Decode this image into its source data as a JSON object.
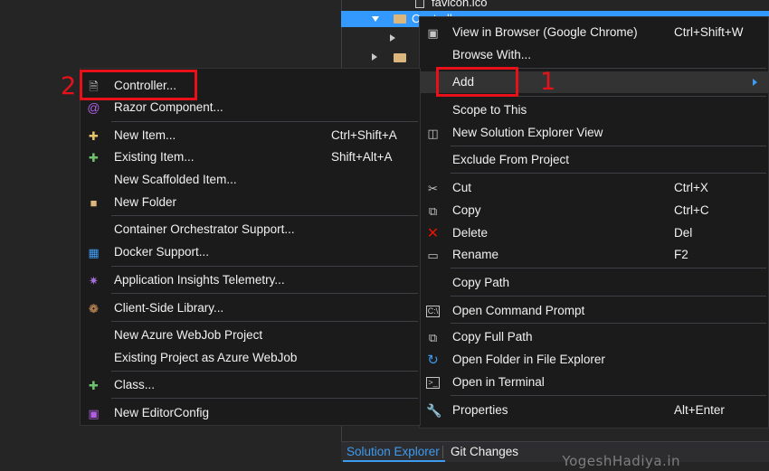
{
  "solution_explorer": {
    "tree": [
      {
        "label": "favicon.ico"
      },
      {
        "label": "Controllers"
      },
      {
        "label": ""
      },
      {
        "label": ""
      }
    ],
    "tabs": [
      {
        "label": "Solution Explorer"
      },
      {
        "label": "Git Changes"
      }
    ]
  },
  "main_menu": {
    "items": [
      {
        "label": "View in Browser (Google Chrome)",
        "shortcut": "Ctrl+Shift+W",
        "icon": "browser-icon"
      },
      {
        "label": "Browse With...",
        "shortcut": "",
        "icon": ""
      },
      {
        "label": "Add",
        "shortcut": "",
        "icon": "",
        "submenu": true
      },
      {
        "label": "Scope to This",
        "shortcut": "",
        "icon": ""
      },
      {
        "label": "New Solution Explorer View",
        "shortcut": "",
        "icon": "new-view-icon"
      },
      {
        "label": "Exclude From Project",
        "shortcut": "",
        "icon": ""
      },
      {
        "label": "Cut",
        "shortcut": "Ctrl+X",
        "icon": "scissors-icon"
      },
      {
        "label": "Copy",
        "shortcut": "Ctrl+C",
        "icon": "copy-icon"
      },
      {
        "label": "Delete",
        "shortcut": "Del",
        "icon": "delete-icon"
      },
      {
        "label": "Rename",
        "shortcut": "F2",
        "icon": "rename-icon"
      },
      {
        "label": "Copy Path",
        "shortcut": "",
        "icon": ""
      },
      {
        "label": "Open Command Prompt",
        "shortcut": "",
        "icon": "command-prompt-icon"
      },
      {
        "label": "Copy Full Path",
        "shortcut": "",
        "icon": "copy-full-path-icon"
      },
      {
        "label": "Open Folder in File Explorer",
        "shortcut": "",
        "icon": "refresh-arrow-icon"
      },
      {
        "label": "Open in Terminal",
        "shortcut": "",
        "icon": "terminal-icon"
      },
      {
        "label": "Properties",
        "shortcut": "Alt+Enter",
        "icon": "wrench-icon"
      }
    ]
  },
  "sub_menu": {
    "items": [
      {
        "label": "Controller...",
        "shortcut": "",
        "icon": "controller-file-icon"
      },
      {
        "label": "Razor Component...",
        "shortcut": "",
        "icon": "razor-icon"
      },
      {
        "label": "New Item...",
        "shortcut": "Ctrl+Shift+A",
        "icon": "new-item-icon"
      },
      {
        "label": "Existing Item...",
        "shortcut": "Shift+Alt+A",
        "icon": "existing-item-icon"
      },
      {
        "label": "New Scaffolded Item...",
        "shortcut": "",
        "icon": ""
      },
      {
        "label": "New Folder",
        "shortcut": "",
        "icon": "new-folder-icon"
      },
      {
        "label": "Container Orchestrator Support...",
        "shortcut": "",
        "icon": ""
      },
      {
        "label": "Docker Support...",
        "shortcut": "",
        "icon": "docker-icon"
      },
      {
        "label": "Application Insights Telemetry...",
        "shortcut": "",
        "icon": "app-insights-icon"
      },
      {
        "label": "Client-Side Library...",
        "shortcut": "",
        "icon": "client-library-icon"
      },
      {
        "label": "New Azure WebJob Project",
        "shortcut": "",
        "icon": ""
      },
      {
        "label": "Existing Project as Azure WebJob",
        "shortcut": "",
        "icon": ""
      },
      {
        "label": "Class...",
        "shortcut": "",
        "icon": "class-icon"
      },
      {
        "label": "New EditorConfig",
        "shortcut": "",
        "icon": "editorconfig-icon"
      }
    ]
  },
  "annotations": {
    "step1": "1",
    "step2": "2"
  },
  "watermark": "YogeshHadiya.in",
  "colors": {
    "menu_bg": "#1b1b1c",
    "selection": "#3399ff",
    "annotation_red": "#e8111a",
    "accent_blue": "#3e9bf0"
  }
}
